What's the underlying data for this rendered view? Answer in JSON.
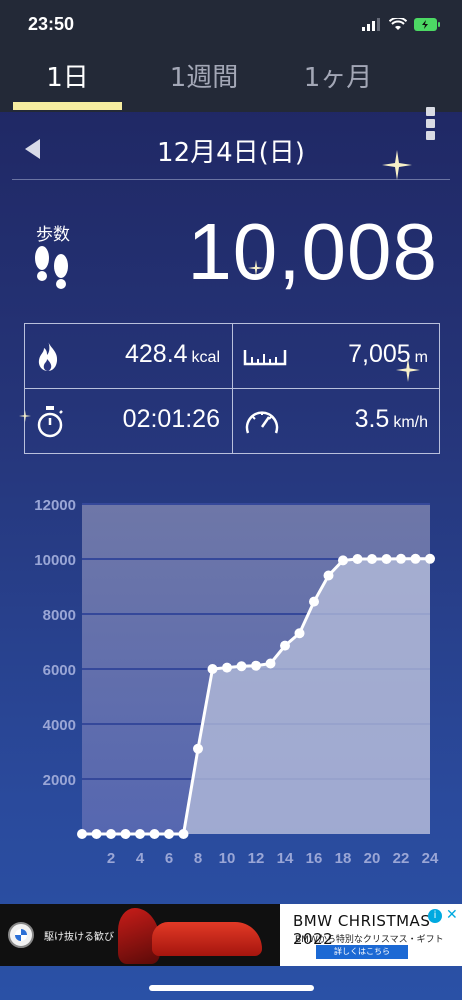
{
  "status": {
    "time": "23:50"
  },
  "tabs": [
    {
      "label": "1日",
      "active": true
    },
    {
      "label": "1週間",
      "active": false
    },
    {
      "label": "1ヶ月",
      "active": false
    }
  ],
  "date": {
    "label": "12月4日(日)"
  },
  "steps": {
    "label": "歩数",
    "value": "10,008"
  },
  "stats": {
    "calories": {
      "value": "428.4",
      "unit": "kcal",
      "icon": "flame-icon"
    },
    "distance": {
      "value": "7,005",
      "unit": "m",
      "icon": "ruler-icon"
    },
    "duration": {
      "value": "02:01:26",
      "icon": "stopwatch-icon"
    },
    "speed": {
      "value": "3.5",
      "unit": "km/h",
      "icon": "speedometer-icon"
    }
  },
  "chart_data": {
    "type": "line",
    "x": [
      0,
      1,
      2,
      3,
      4,
      5,
      6,
      7,
      8,
      9,
      10,
      11,
      12,
      13,
      14,
      15,
      16,
      17,
      18,
      19,
      20,
      21,
      22,
      23,
      24
    ],
    "values": [
      0,
      0,
      0,
      0,
      0,
      0,
      0,
      0,
      3100,
      6000,
      6050,
      6100,
      6120,
      6200,
      6850,
      7300,
      8450,
      9400,
      9950,
      10000,
      10000,
      10000,
      10008,
      10008,
      10008
    ],
    "x_tick_labels": [
      "2",
      "4",
      "6",
      "8",
      "10",
      "12",
      "14",
      "16",
      "18",
      "20",
      "22",
      "24"
    ],
    "x_ticks": [
      2,
      4,
      6,
      8,
      10,
      12,
      14,
      16,
      18,
      20,
      22,
      24
    ],
    "y_ticks": [
      2000,
      4000,
      6000,
      8000,
      10000,
      12000
    ],
    "y_tick_labels": [
      "2000",
      "4000",
      "6000",
      "8000",
      "10000",
      "12000"
    ],
    "xlim": [
      0,
      24
    ],
    "ylim": [
      0,
      12000
    ],
    "grid": true,
    "line_color": "#ffffff",
    "fill_color": "#b8c0dc"
  },
  "ad": {
    "tagline": "駆け抜ける歓び",
    "title": "BMW CHRISTMAS 2022",
    "subtitle": "BMWから特別なクリスマス・ギフト",
    "cta": "詳しくはこちら"
  }
}
